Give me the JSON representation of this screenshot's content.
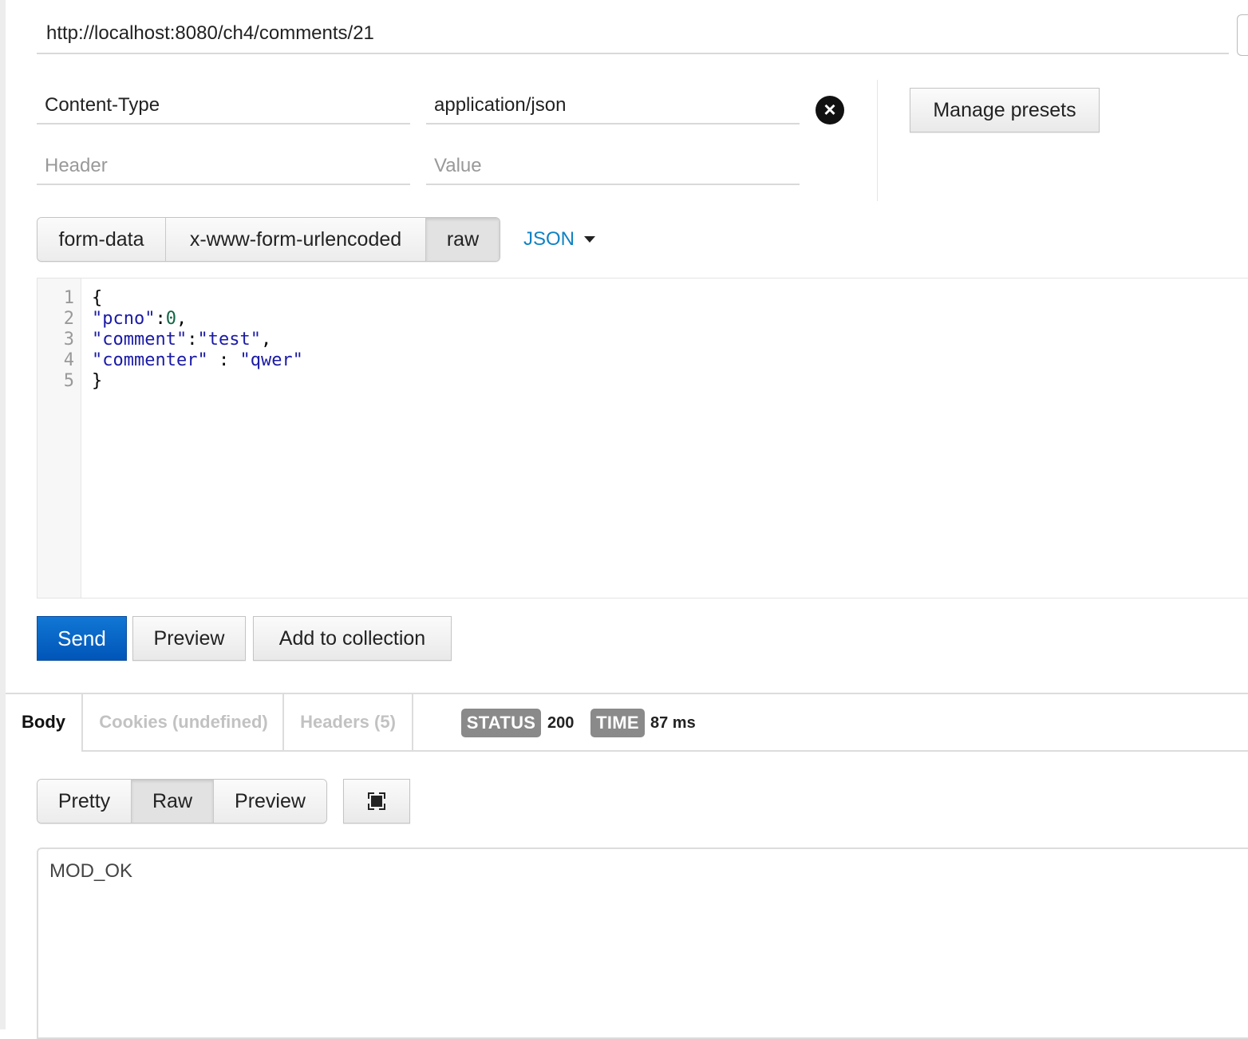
{
  "request": {
    "url": "http://localhost:8080/ch4/comments/21",
    "headers": [
      {
        "key": "Content-Type",
        "value": "application/json"
      }
    ],
    "new_header": {
      "key_placeholder": "Header",
      "value_placeholder": "Value"
    },
    "manage_presets_label": "Manage presets"
  },
  "body_modes": {
    "options": [
      "form-data",
      "x-www-form-urlencoded",
      "raw"
    ],
    "selected": "raw",
    "format_label": "JSON"
  },
  "editor": {
    "line_numbers": [
      "1",
      "2",
      "3",
      "4",
      "5"
    ],
    "lines": [
      [
        {
          "t": "p",
          "v": "{"
        }
      ],
      [
        {
          "t": "key",
          "v": "\"pcno\""
        },
        {
          "t": "p",
          "v": ":"
        },
        {
          "t": "num",
          "v": "0"
        },
        {
          "t": "p",
          "v": ","
        }
      ],
      [
        {
          "t": "key",
          "v": "\"comment\""
        },
        {
          "t": "p",
          "v": ":"
        },
        {
          "t": "str",
          "v": "\"test\""
        },
        {
          "t": "p",
          "v": ","
        }
      ],
      [
        {
          "t": "key",
          "v": "\"commenter\""
        },
        {
          "t": "p",
          "v": " : "
        },
        {
          "t": "str",
          "v": "\"qwer\""
        }
      ],
      [
        {
          "t": "p",
          "v": "}"
        }
      ]
    ]
  },
  "actions": {
    "send_label": "Send",
    "preview_label": "Preview",
    "add_to_collection_label": "Add to collection"
  },
  "response": {
    "tabs": {
      "body": "Body",
      "cookies": "Cookies (undefined)",
      "headers": "Headers (5)"
    },
    "status_label": "STATUS",
    "status_value": "200",
    "time_label": "TIME",
    "time_value": "87 ms",
    "view_modes": [
      "Pretty",
      "Raw",
      "Preview"
    ],
    "selected_view": "Raw",
    "body_text": "MOD_OK"
  }
}
